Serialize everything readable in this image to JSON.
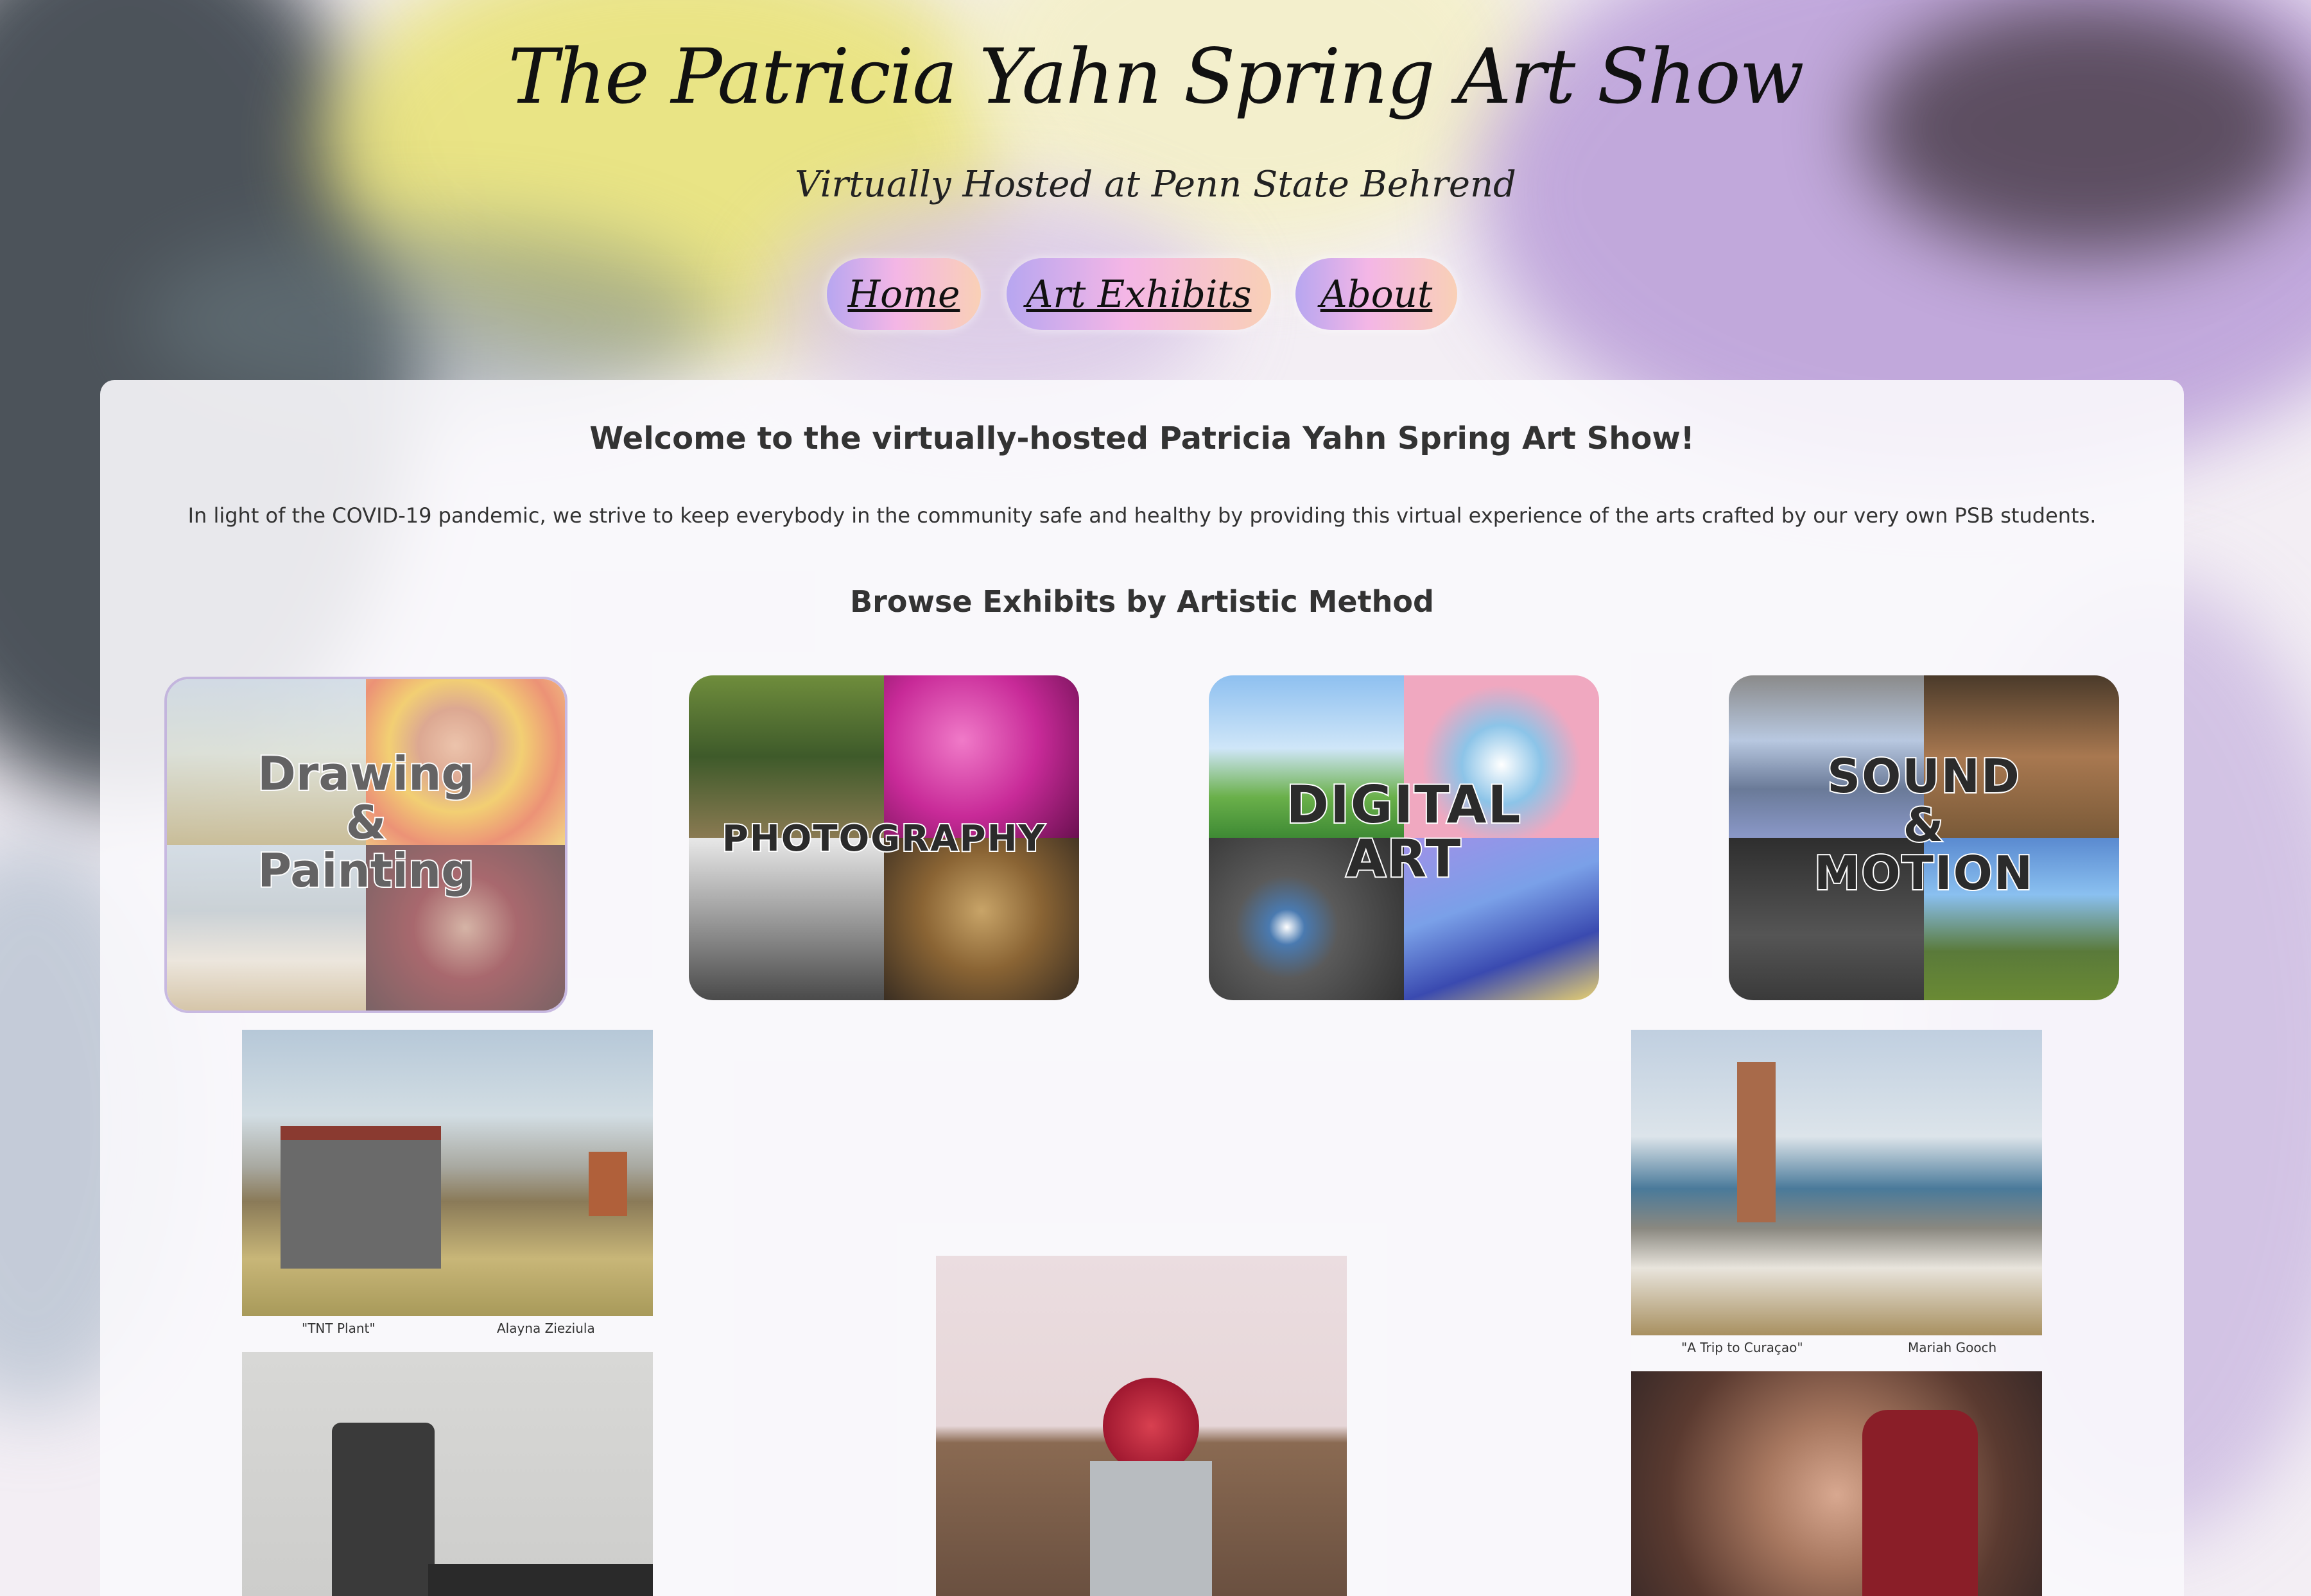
{
  "header": {
    "title": "The Patricia Yahn Spring Art Show",
    "subtitle": "Virtually Hosted at Penn State Behrend"
  },
  "nav": {
    "home": "Home",
    "exhibits": "Art Exhibits",
    "about": "About"
  },
  "main": {
    "welcome": "Welcome to the virtually-hosted Patricia Yahn Spring Art Show!",
    "intro": "In light of the COVID-19 pandemic, we strive to keep everybody in the community safe and healthy by providing this virtual experience of the arts crafted by our very own PSB students.",
    "browse": "Browse Exhibits by Artistic Method"
  },
  "exhibits": [
    {
      "label": "Drawing & Painting",
      "lines": [
        "Drawing",
        "&",
        "Painting"
      ]
    },
    {
      "label": "PHOTOGRAPHY",
      "lines": [
        "PHOTOGRAPHY"
      ]
    },
    {
      "label": "DIGITAL ART",
      "lines": [
        "DIGITAL",
        "ART"
      ]
    },
    {
      "label": "SOUND & MOTION",
      "lines": [
        "SOUND",
        "&",
        "MOTION"
      ]
    }
  ],
  "gallery": [
    {
      "title": "\"TNT Plant\"",
      "artist": "Alayna Zieziula"
    },
    {
      "title": "\"A Trip to Curaçao\"",
      "artist": "Mariah Gooch"
    }
  ]
}
